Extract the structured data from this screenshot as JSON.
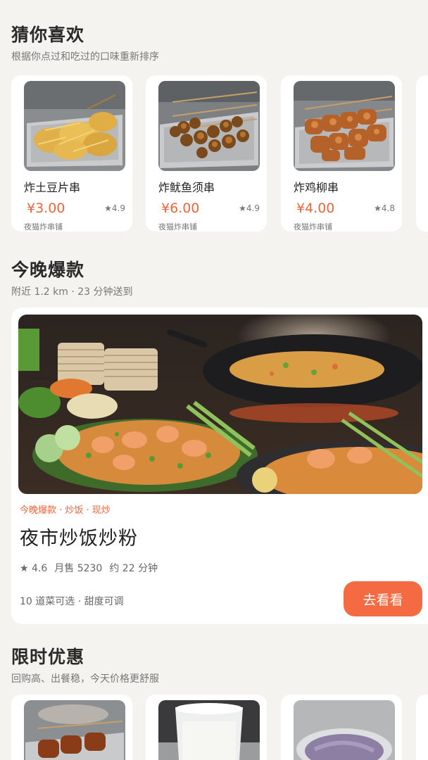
{
  "guess": {
    "title": "猜你喜欢",
    "subtitle": "根据你点过和吃过的口味重新排序",
    "items": [
      {
        "name": "炸土豆片串",
        "price": "¥3.00",
        "rating": "★4.9",
        "shop": "夜猫炸串铺"
      },
      {
        "name": "炸鱿鱼须串",
        "price": "¥6.00",
        "rating": "★4.9",
        "shop": "夜猫炸串铺"
      },
      {
        "name": "炸鸡柳串",
        "price": "¥4.00",
        "rating": "★4.8",
        "shop": "夜猫炸串铺"
      }
    ]
  },
  "tonight": {
    "title": "今晚爆款",
    "subtitle": "附近 1.2 km · 23 分钟送到",
    "feature": {
      "tags": "今晚爆款 · 炒饭 · 现炒",
      "title": "夜市炒饭炒粉",
      "rating": "★ 4.6",
      "sales": "月售 5230",
      "eta": "约 22 分钟",
      "options": "10 道菜可选 · 甜度可调",
      "button": "去看看"
    }
  },
  "deals": {
    "title": "限时优惠",
    "subtitle": "回购高、出餐稳，今天价格更舒服"
  }
}
